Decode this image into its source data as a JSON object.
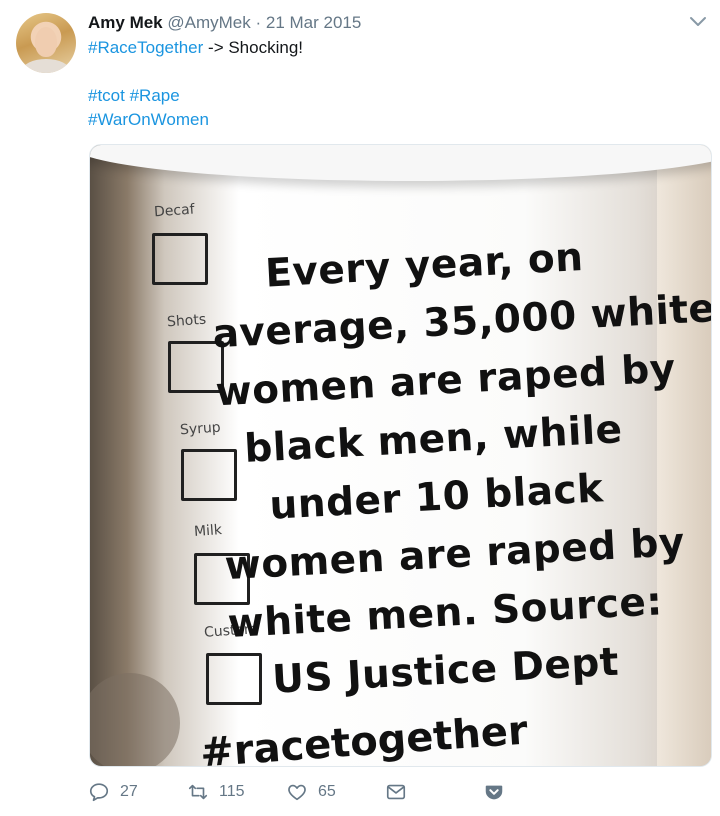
{
  "user": {
    "name": "Amy Mek",
    "handle": "@AmyMek",
    "separator": "·",
    "date": "21 Mar 2015"
  },
  "tweet": {
    "hashtag_race": "#RaceTogether",
    "text_line1_rest": " -> Shocking!",
    "hashtag_tcot": "#tcot",
    "hashtag_rape": "#Rape",
    "hashtag_waronwomen": "#WarOnWomen"
  },
  "image": {
    "box_labels": [
      "Decaf",
      "Shots",
      "Syrup",
      "Milk",
      "Custom"
    ],
    "handwritten_lines": [
      "Every year, on",
      "average, 35,000 white",
      "women are raped by",
      "black men, while",
      "under 10 black",
      "women are raped by",
      "white men. Source:",
      "US Justice Dept"
    ],
    "bottom_text": "#racetogether"
  },
  "actions": {
    "reply_count": "27",
    "retweet_count": "115",
    "like_count": "65"
  },
  "icons": {
    "reply": "reply-icon",
    "retweet": "retweet-icon",
    "like": "heart-icon",
    "dm": "envelope-icon",
    "save": "pocket-icon",
    "menu": "chevron-down-icon"
  },
  "colors": {
    "link": "#1b95e0",
    "meta": "#657786",
    "text": "#14171a"
  }
}
